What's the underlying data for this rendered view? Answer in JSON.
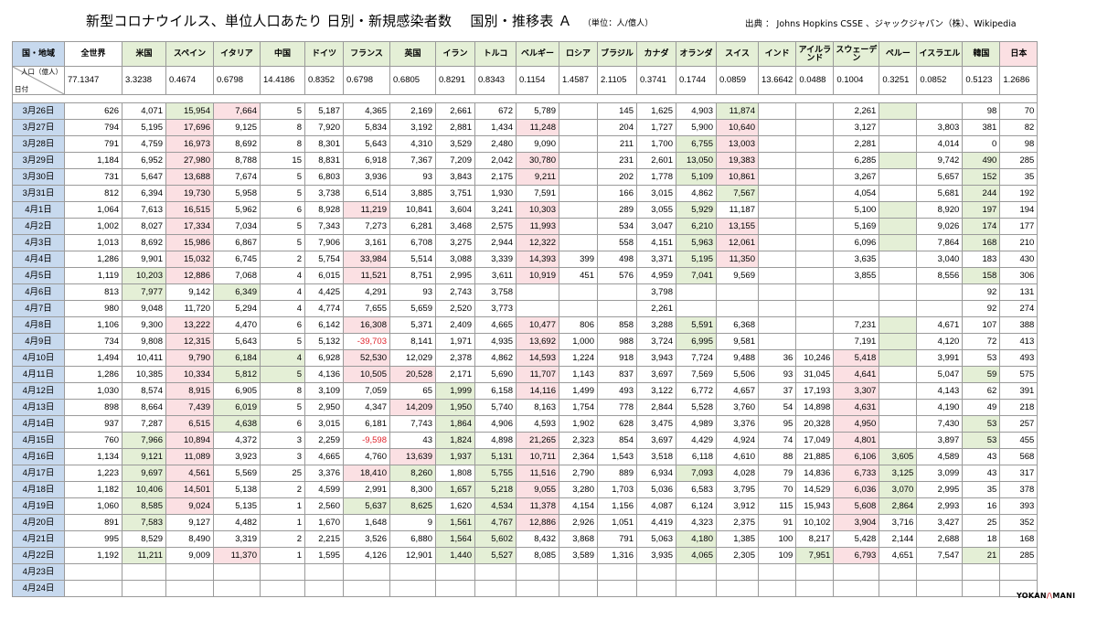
{
  "title": "新型コロナウイルス、単位人口あたり 日別・新規感染者数　 国別・推移表 Ａ",
  "unit": "（単位：人/億人）",
  "source": "出典 ： Johns Hopkins CSSE 、ジャックジャパン（株）、Wikipedia",
  "corner_label": "国・地域",
  "pop_label": "人口（億人）",
  "date_label": "日付",
  "columns": [
    "全世界",
    "米国",
    "スペイン",
    "イタリア",
    "中国",
    "ドイツ",
    "フランス",
    "英国",
    "イラン",
    "トルコ",
    "ベルギー",
    "ロシア",
    "ブラジル",
    "カナダ",
    "オランダ",
    "スイス",
    "インド",
    "アイルランド",
    "スウェーデン",
    "ペルー",
    "イスラエル",
    "韓国",
    "日本"
  ],
  "population": [
    "77.1347",
    "3.3238",
    "0.4674",
    "0.6798",
    "14.4186",
    "0.8352",
    "0.6798",
    "0.6805",
    "0.8291",
    "0.8343",
    "0.1154",
    "1.4587",
    "2.1105",
    "0.3741",
    "0.1744",
    "0.0859",
    "13.6642",
    "0.0488",
    "0.1004",
    "0.3251",
    "0.0852",
    "0.5123",
    "1.2686"
  ],
  "rows": [
    {
      "date": "3月26日",
      "v": [
        "626",
        "4,071",
        "15,954",
        "7,664",
        "5",
        "5,187",
        "4,365",
        "2,169",
        "2,661",
        "672",
        "5,789",
        "",
        "145",
        "1,625",
        "4,903",
        "11,874",
        "",
        "",
        "2,261",
        "",
        "",
        "98",
        "70"
      ]
    },
    {
      "date": "3月27日",
      "v": [
        "794",
        "5,195",
        "17,696",
        "9,125",
        "8",
        "7,920",
        "5,834",
        "3,192",
        "2,881",
        "1,434",
        "11,248",
        "",
        "204",
        "1,727",
        "5,900",
        "10,640",
        "",
        "",
        "3,127",
        "",
        "3,803",
        "381",
        "82"
      ]
    },
    {
      "date": "3月28日",
      "v": [
        "791",
        "4,759",
        "16,973",
        "8,692",
        "8",
        "8,301",
        "5,643",
        "4,310",
        "3,529",
        "2,480",
        "9,090",
        "",
        "211",
        "1,700",
        "6,755",
        "13,003",
        "",
        "",
        "2,281",
        "",
        "4,014",
        "0",
        "98"
      ]
    },
    {
      "date": "3月29日",
      "v": [
        "1,184",
        "6,952",
        "27,980",
        "8,788",
        "15",
        "8,831",
        "6,918",
        "7,367",
        "7,209",
        "2,042",
        "30,780",
        "",
        "231",
        "2,601",
        "13,050",
        "19,383",
        "",
        "",
        "6,285",
        "",
        "9,742",
        "490",
        "285"
      ]
    },
    {
      "date": "3月30日",
      "v": [
        "731",
        "5,647",
        "13,688",
        "7,674",
        "5",
        "6,803",
        "3,936",
        "93",
        "3,843",
        "2,175",
        "9,211",
        "",
        "202",
        "1,778",
        "5,109",
        "10,861",
        "",
        "",
        "3,267",
        "",
        "5,657",
        "152",
        "35"
      ]
    },
    {
      "date": "3月31日",
      "v": [
        "812",
        "6,394",
        "19,730",
        "5,958",
        "5",
        "3,738",
        "6,514",
        "3,885",
        "3,751",
        "1,930",
        "7,591",
        "",
        "166",
        "3,015",
        "4,862",
        "7,567",
        "",
        "",
        "4,054",
        "",
        "5,681",
        "244",
        "192"
      ]
    },
    {
      "date": "4月1日",
      "v": [
        "1,064",
        "7,613",
        "16,515",
        "5,962",
        "6",
        "8,928",
        "11,219",
        "10,841",
        "3,604",
        "3,241",
        "10,303",
        "",
        "289",
        "3,055",
        "5,929",
        "11,187",
        "",
        "",
        "5,100",
        "",
        "8,920",
        "197",
        "194"
      ]
    },
    {
      "date": "4月2日",
      "v": [
        "1,002",
        "8,027",
        "17,334",
        "7,034",
        "5",
        "7,343",
        "7,273",
        "6,281",
        "3,468",
        "2,575",
        "11,993",
        "",
        "534",
        "3,047",
        "6,210",
        "13,155",
        "",
        "",
        "5,169",
        "",
        "9,026",
        "174",
        "177"
      ]
    },
    {
      "date": "4月3日",
      "v": [
        "1,013",
        "8,692",
        "15,986",
        "6,867",
        "5",
        "7,906",
        "3,161",
        "6,708",
        "3,275",
        "2,944",
        "12,322",
        "",
        "558",
        "4,151",
        "5,963",
        "12,061",
        "",
        "",
        "6,096",
        "",
        "7,864",
        "168",
        "210"
      ]
    },
    {
      "date": "4月4日",
      "v": [
        "1,286",
        "9,901",
        "15,032",
        "6,745",
        "2",
        "5,754",
        "33,984",
        "5,514",
        "3,088",
        "3,339",
        "14,393",
        "399",
        "498",
        "3,371",
        "5,195",
        "11,350",
        "",
        "",
        "3,635",
        "",
        "3,040",
        "183",
        "430"
      ]
    },
    {
      "date": "4月5日",
      "v": [
        "1,119",
        "10,203",
        "12,886",
        "7,068",
        "4",
        "6,015",
        "11,521",
        "8,751",
        "2,995",
        "3,611",
        "10,919",
        "451",
        "576",
        "4,959",
        "7,041",
        "9,569",
        "",
        "",
        "3,855",
        "",
        "8,556",
        "158",
        "306"
      ]
    },
    {
      "date": "4月6日",
      "v": [
        "813",
        "7,977",
        "9,142",
        "6,349",
        "4",
        "4,425",
        "4,291",
        "93",
        "2,743",
        "3,758",
        "",
        "",
        "",
        "3,798",
        "",
        "",
        "",
        "",
        "",
        "",
        "",
        "92",
        "131"
      ]
    },
    {
      "date": "4月7日",
      "v": [
        "980",
        "9,048",
        "11,720",
        "5,294",
        "4",
        "4,774",
        "7,655",
        "5,659",
        "2,520",
        "3,773",
        "",
        "",
        "",
        "2,261",
        "",
        "",
        "",
        "",
        "",
        "",
        "",
        "92",
        "274"
      ]
    },
    {
      "date": "4月8日",
      "v": [
        "1,106",
        "9,300",
        "13,222",
        "4,470",
        "6",
        "6,142",
        "16,308",
        "5,371",
        "2,409",
        "4,665",
        "10,477",
        "806",
        "858",
        "3,288",
        "5,591",
        "6,368",
        "",
        "",
        "7,231",
        "",
        "4,671",
        "107",
        "388"
      ]
    },
    {
      "date": "4月9日",
      "v": [
        "734",
        "9,808",
        "12,315",
        "5,643",
        "5",
        "5,132",
        "-39,703",
        "8,141",
        "1,971",
        "4,935",
        "13,692",
        "1,000",
        "988",
        "3,724",
        "6,995",
        "9,581",
        "",
        "",
        "7,191",
        "",
        "4,120",
        "72",
        "413"
      ]
    },
    {
      "date": "4月10日",
      "v": [
        "1,494",
        "10,411",
        "9,790",
        "6,184",
        "4",
        "6,928",
        "52,530",
        "12,029",
        "2,378",
        "4,862",
        "14,593",
        "1,224",
        "918",
        "3,943",
        "7,724",
        "9,488",
        "36",
        "10,246",
        "5,418",
        "",
        "3,991",
        "53",
        "493"
      ]
    },
    {
      "date": "4月11日",
      "v": [
        "1,286",
        "10,385",
        "10,334",
        "5,812",
        "5",
        "4,136",
        "10,505",
        "20,528",
        "2,171",
        "5,690",
        "11,707",
        "1,143",
        "837",
        "3,697",
        "7,569",
        "5,506",
        "93",
        "31,045",
        "4,641",
        "",
        "5,047",
        "59",
        "575"
      ]
    },
    {
      "date": "4月12日",
      "v": [
        "1,030",
        "8,574",
        "8,915",
        "6,905",
        "8",
        "3,109",
        "7,059",
        "65",
        "1,999",
        "6,158",
        "14,116",
        "1,499",
        "493",
        "3,122",
        "6,772",
        "4,657",
        "37",
        "17,193",
        "3,307",
        "",
        "4,143",
        "62",
        "391"
      ]
    },
    {
      "date": "4月13日",
      "v": [
        "898",
        "8,664",
        "7,439",
        "6,019",
        "5",
        "2,950",
        "4,347",
        "14,209",
        "1,950",
        "5,740",
        "8,163",
        "1,754",
        "778",
        "2,844",
        "5,528",
        "3,760",
        "54",
        "14,898",
        "4,631",
        "",
        "4,190",
        "49",
        "218"
      ]
    },
    {
      "date": "4月14日",
      "v": [
        "937",
        "7,287",
        "6,515",
        "4,638",
        "6",
        "3,015",
        "6,181",
        "7,743",
        "1,864",
        "4,906",
        "4,593",
        "1,902",
        "628",
        "3,475",
        "4,989",
        "3,376",
        "95",
        "20,328",
        "4,950",
        "",
        "7,430",
        "53",
        "257"
      ]
    },
    {
      "date": "4月15日",
      "v": [
        "760",
        "7,966",
        "10,894",
        "4,372",
        "3",
        "2,259",
        "-9,598",
        "43",
        "1,824",
        "4,898",
        "21,265",
        "2,323",
        "854",
        "3,697",
        "4,429",
        "4,924",
        "74",
        "17,049",
        "4,801",
        "",
        "3,897",
        "53",
        "455"
      ]
    },
    {
      "date": "4月16日",
      "v": [
        "1,134",
        "9,121",
        "11,089",
        "3,923",
        "3",
        "4,665",
        "4,760",
        "13,639",
        "1,937",
        "5,131",
        "10,711",
        "2,364",
        "1,543",
        "3,518",
        "6,118",
        "4,610",
        "88",
        "21,885",
        "6,106",
        "3,605",
        "4,589",
        "43",
        "568"
      ]
    },
    {
      "date": "4月17日",
      "v": [
        "1,223",
        "9,697",
        "4,561",
        "5,569",
        "25",
        "3,376",
        "18,410",
        "8,260",
        "1,808",
        "5,755",
        "11,516",
        "2,790",
        "889",
        "6,934",
        "7,093",
        "4,028",
        "79",
        "14,836",
        "6,733",
        "3,125",
        "3,099",
        "43",
        "317"
      ]
    },
    {
      "date": "4月18日",
      "v": [
        "1,182",
        "10,406",
        "14,501",
        "5,138",
        "2",
        "4,599",
        "2,991",
        "8,300",
        "1,657",
        "5,218",
        "9,055",
        "3,280",
        "1,703",
        "5,036",
        "6,583",
        "3,795",
        "70",
        "14,529",
        "6,036",
        "3,070",
        "2,995",
        "35",
        "378"
      ]
    },
    {
      "date": "4月19日",
      "v": [
        "1,060",
        "8,585",
        "9,024",
        "5,135",
        "1",
        "2,560",
        "5,637",
        "8,625",
        "1,620",
        "4,534",
        "11,378",
        "4,154",
        "1,156",
        "4,087",
        "6,124",
        "3,912",
        "115",
        "15,943",
        "5,608",
        "2,864",
        "2,993",
        "16",
        "393"
      ]
    },
    {
      "date": "4月20日",
      "v": [
        "891",
        "7,583",
        "9,127",
        "4,482",
        "1",
        "1,670",
        "1,648",
        "9",
        "1,561",
        "4,767",
        "12,886",
        "2,926",
        "1,051",
        "4,419",
        "4,323",
        "2,375",
        "91",
        "10,102",
        "3,904",
        "3,716",
        "3,427",
        "25",
        "352"
      ]
    },
    {
      "date": "4月21日",
      "v": [
        "995",
        "8,529",
        "8,490",
        "3,319",
        "2",
        "2,215",
        "3,526",
        "6,880",
        "1,564",
        "5,602",
        "8,432",
        "3,868",
        "791",
        "5,063",
        "4,180",
        "1,385",
        "100",
        "8,217",
        "5,428",
        "2,144",
        "2,688",
        "18",
        "168"
      ]
    },
    {
      "date": "4月22日",
      "v": [
        "1,192",
        "11,211",
        "9,009",
        "11,370",
        "1",
        "1,595",
        "4,126",
        "12,901",
        "1,440",
        "5,527",
        "8,085",
        "3,589",
        "1,316",
        "3,935",
        "4,065",
        "2,305",
        "109",
        "7,951",
        "6,793",
        "4,651",
        "7,547",
        "21",
        "285"
      ]
    },
    {
      "date": "4月23日",
      "v": [
        "",
        "",
        "",
        "",
        "",
        "",
        "",
        "",
        "",
        "",
        "",
        "",
        "",
        "",
        "",
        "",
        "",
        "",
        "",
        "",
        "",
        "",
        ""
      ]
    },
    {
      "date": "4月24日",
      "v": [
        "",
        "",
        "",
        "",
        "",
        "",
        "",
        "",
        "",
        "",
        "",
        "",
        "",
        "",
        "",
        "",
        "",
        "",
        "",
        "",
        "",
        "",
        ""
      ]
    }
  ],
  "logo_text": "YOKAN MANI",
  "colors": {
    "date_bg": "#c7d9ee",
    "header_bg": "#e4efd6",
    "highlight_red": "#fbe0e3",
    "highlight_green": "#e4efd6",
    "negative": "#e0242c"
  }
}
